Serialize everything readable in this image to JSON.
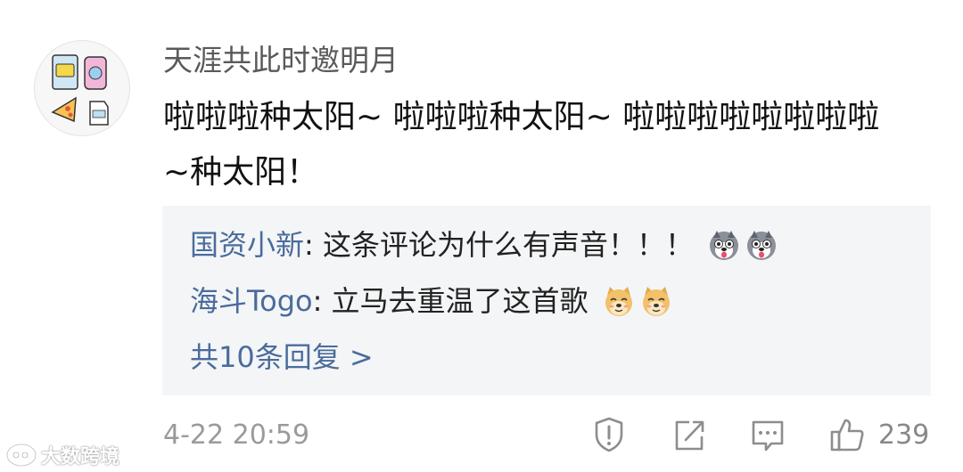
{
  "comment": {
    "username": "天涯共此时邀明月",
    "text_lines": [
      "啦啦啦种太阳~ 啦啦啦种太阳~ 啦啦啦啦啦啦啦啦",
      "~种太阳！"
    ],
    "timestamp": "4-22 20:59",
    "like_count": "239"
  },
  "replies": [
    {
      "author": "国资小新",
      "separator": ": ",
      "text": "这条评论为什么有声音！！！",
      "emoji": [
        "husky-face-icon",
        "husky-face-icon"
      ]
    },
    {
      "author": "海斗Togo",
      "separator": ": ",
      "text": "立马去重温了这首歌",
      "emoji": [
        "doge-face-icon",
        "doge-face-icon"
      ]
    }
  ],
  "more_replies_label": "共10条回复 >",
  "actions": [
    "report-icon",
    "share-icon",
    "comment-icon",
    "like-icon"
  ],
  "watermark": {
    "text": "大数跨境"
  },
  "colors": {
    "link": "#4a6c9c",
    "reply_background": "#f4f5f7",
    "meta_text": "#9a9a9a"
  }
}
